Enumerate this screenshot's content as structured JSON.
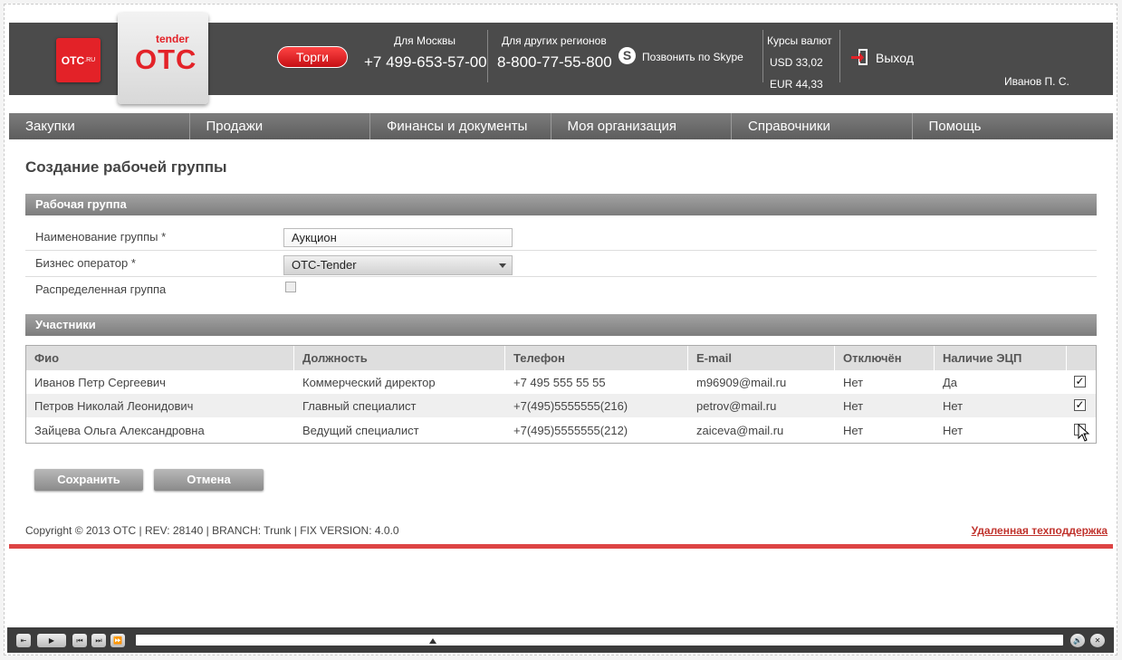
{
  "header": {
    "otcru_logo": "OTC",
    "otcru_suffix": ".RU",
    "logo_tender": "tender",
    "logo_otc": "OTC",
    "torgi_button": "Торги",
    "moscow_label": "Для Москвы",
    "moscow_phone": "+7 499-653-57-00",
    "regions_label": "Для других регионов",
    "regions_phone": "8-800-77-55-800",
    "skype_label": "Позвонить по Skype",
    "rates_label": "Курсы валют",
    "usd": "USD 33,02",
    "eur": "EUR 44,33",
    "exit_label": "Выход",
    "user_name": "Иванов П. С."
  },
  "nav": [
    "Закупки",
    "Продажи",
    "Финансы и документы",
    "Моя организация",
    "Справочники",
    "Помощь"
  ],
  "page_title": "Создание рабочей группы",
  "workgroup": {
    "section_title": "Рабочая группа",
    "name_label": "Наименование группы *",
    "name_value": "Аукцион",
    "operator_label": "Бизнес оператор *",
    "operator_value": "OTC-Tender",
    "distributed_label": "Распределенная группа"
  },
  "participants": {
    "section_title": "Участники",
    "columns": [
      "Фио",
      "Должность",
      "Телефон",
      "E-mail",
      "Отключён",
      "Наличие ЭЦП",
      ""
    ],
    "rows": [
      {
        "name": "Иванов Петр Сергеевич",
        "position": "Коммерческий директор",
        "phone": "+7 495 555 55 55",
        "email": "m96909@mail.ru",
        "disabled": "Нет",
        "ecp": "Да",
        "checked": true
      },
      {
        "name": "Петров Николай Леонидович",
        "position": "Главный специалист",
        "phone": "+7(495)5555555(216)",
        "email": "petrov@mail.ru",
        "disabled": "Нет",
        "ecp": "Нет",
        "checked": true
      },
      {
        "name": "Зайцева Ольга Александровна",
        "position": "Ведущий специалист",
        "phone": "+7(495)5555555(212)",
        "email": "zaiceva@mail.ru",
        "disabled": "Нет",
        "ecp": "Нет",
        "checked": false
      }
    ]
  },
  "buttons": {
    "save": "Сохранить",
    "cancel": "Отмена"
  },
  "footer": {
    "copyright": "Copyright © 2013 OTC | REV: 28140 | BRANCH: Trunk | FIX VERSION: 4.0.0",
    "support": "Удаленная техподдержка"
  },
  "player": {
    "progress": 0.32
  }
}
